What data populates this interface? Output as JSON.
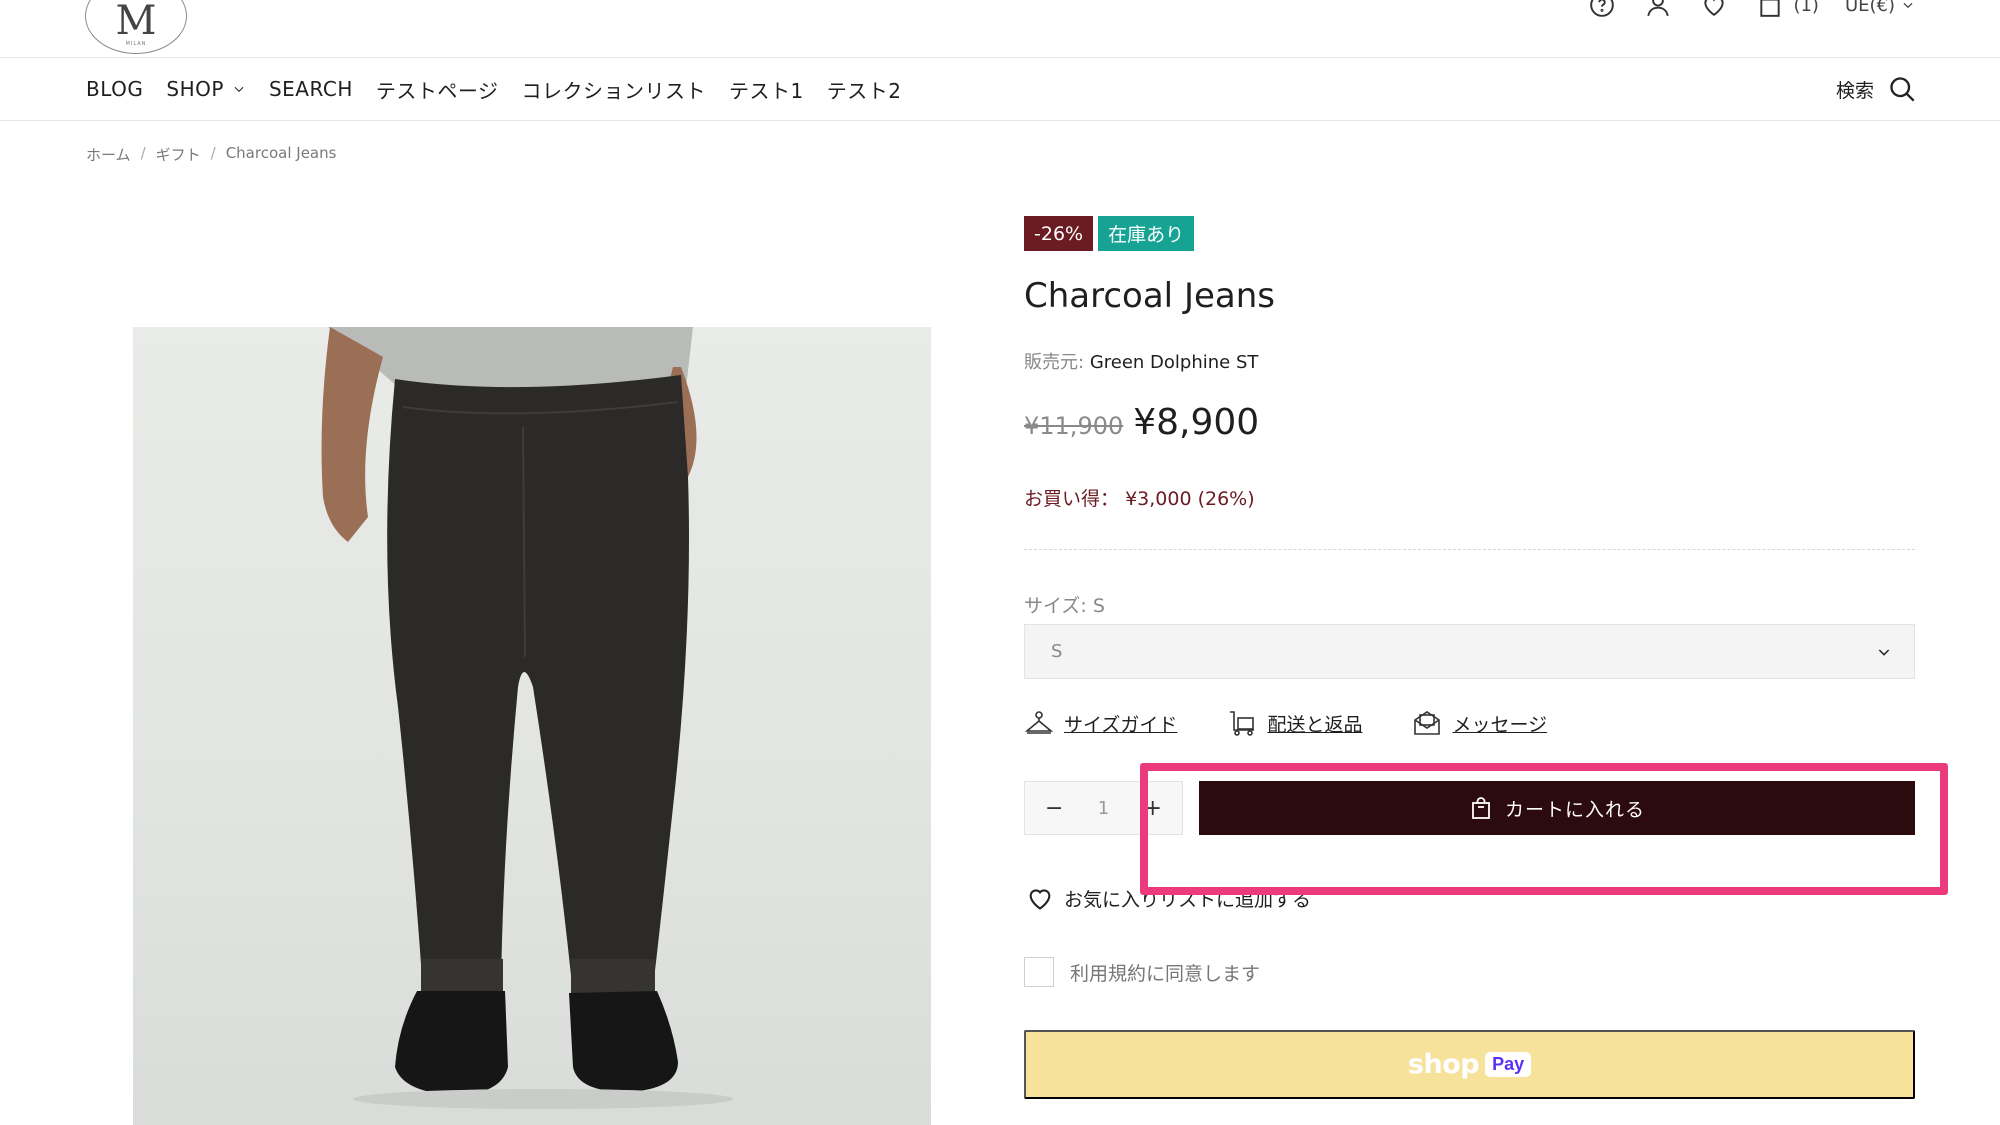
{
  "header": {
    "logo_letter": "M",
    "logo_subtext": "MILAN",
    "cart_count": "(1)",
    "currency": "UE(€)",
    "icons": [
      "help-icon",
      "account-icon",
      "wishlist-icon",
      "cart-icon",
      "chevron-down-icon"
    ]
  },
  "nav": {
    "items": [
      {
        "label": "BLOG"
      },
      {
        "label": "SHOP"
      },
      {
        "label": "SEARCH"
      },
      {
        "label": "テストページ"
      },
      {
        "label": "コレクションリスト"
      },
      {
        "label": "テスト1"
      },
      {
        "label": "テスト2"
      }
    ],
    "search_label": "検索"
  },
  "breadcrumb": {
    "items": [
      "ホーム",
      "ギフト",
      "Charcoal Jeans"
    ],
    "separator": "/"
  },
  "product": {
    "badge_sale": "-26%",
    "badge_stock": "在庫あり",
    "title": "Charcoal Jeans",
    "vendor_label": "販売元:",
    "vendor_name": "Green Dolphine ST",
    "price_old": "¥11,900",
    "price_new": "¥8,900",
    "savings_label": "お買い得：",
    "savings_value": "¥3,000 (26%)",
    "size_label": "サイズ: S",
    "size_selected": "S",
    "links": {
      "size_guide": "サイズガイド",
      "shipping": "配送と返品",
      "message": "メッセージ"
    },
    "quantity": {
      "minus": "−",
      "value": "1",
      "plus": "+"
    },
    "add_to_cart": "カートに入れる",
    "wishlist": "お気に入りリストに追加する",
    "terms": "利用規約に同意します",
    "shop_pay_word": "shop",
    "shop_pay_badge": "Pay"
  },
  "colors": {
    "sale_badge": "#6b1c22",
    "stock_badge": "#16a394",
    "add_to_cart_bg": "#2b0b0d",
    "shop_pay_bg": "#f7e29b",
    "highlight": "#ec3b7c"
  }
}
